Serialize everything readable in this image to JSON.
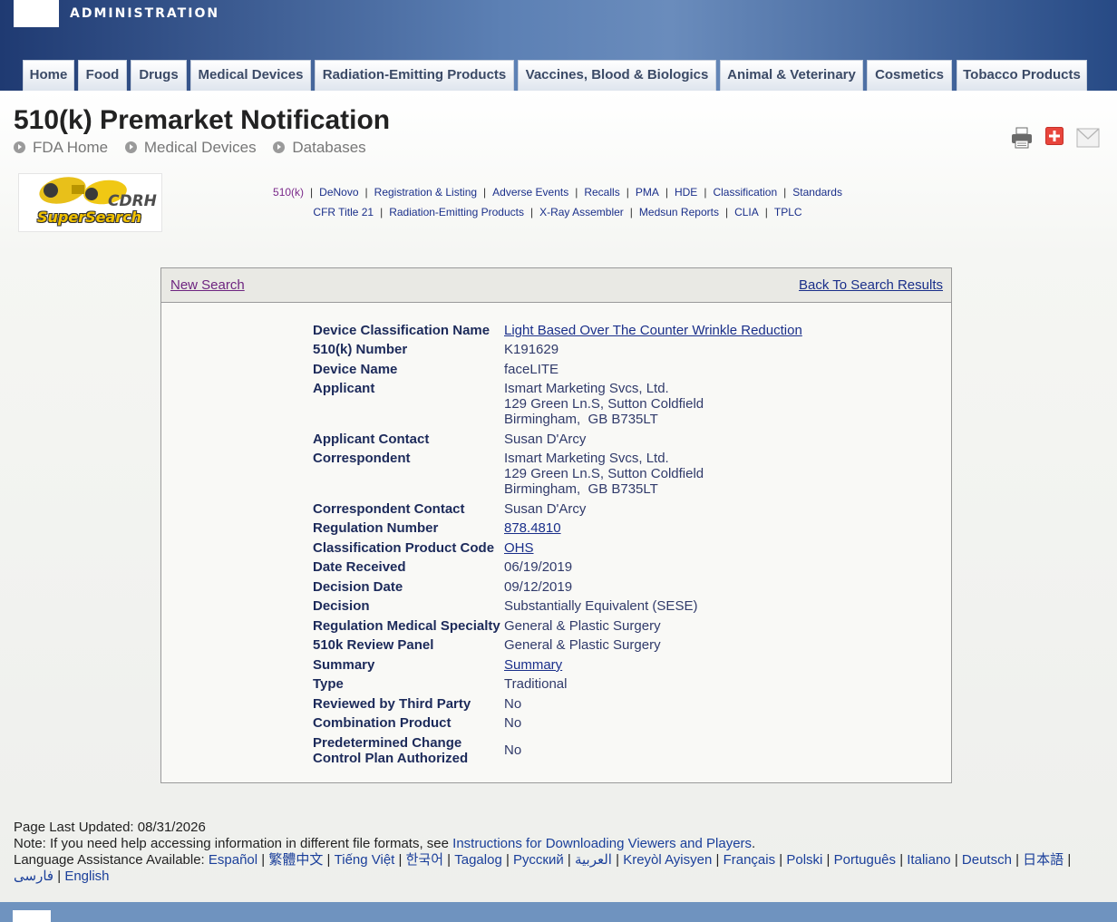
{
  "header": {
    "admin_text": "ADMINISTRATION",
    "nav_tabs": [
      "Home",
      "Food",
      "Drugs",
      "Medical Devices",
      "Radiation-Emitting Products",
      "Vaccines, Blood & Biologics",
      "Animal & Veterinary",
      "Cosmetics",
      "Tobacco Products"
    ]
  },
  "page": {
    "title": "510(k) Premarket Notification",
    "breadcrumbs": [
      "FDA Home",
      "Medical Devices",
      "Databases"
    ],
    "share_icons": [
      "print-icon",
      "add-share-icon",
      "email-icon"
    ]
  },
  "cdrh_logo": {
    "line1": "CDRH",
    "line2": "SuperSearch"
  },
  "sublinks": {
    "row1": [
      "510(k)",
      "DeNovo",
      "Registration & Listing",
      "Adverse Events",
      "Recalls",
      "PMA",
      "HDE",
      "Classification",
      "Standards"
    ],
    "row2": [
      "CFR Title 21",
      "Radiation-Emitting Products",
      "X-Ray Assembler",
      "Medsun Reports",
      "CLIA",
      "TPLC"
    ]
  },
  "panel": {
    "new_search": "New Search",
    "back_to_results": "Back To Search Results"
  },
  "record": {
    "device_classification_name": {
      "label": "Device Classification Name",
      "value": "Light Based Over The Counter Wrinkle Reduction"
    },
    "k_number": {
      "label": "510(k) Number",
      "value": "K191629"
    },
    "device_name": {
      "label": "Device Name",
      "value": "faceLITE"
    },
    "applicant": {
      "label": "Applicant",
      "line1": "Ismart Marketing Svcs, Ltd.",
      "line2": "129 Green Ln.S, Sutton Coldfield",
      "line3": "Birmingham,  GB B735LT"
    },
    "applicant_contact": {
      "label": "Applicant Contact",
      "value": "Susan D'Arcy"
    },
    "correspondent": {
      "label": "Correspondent",
      "line1": "Ismart Marketing Svcs, Ltd.",
      "line2": "129 Green Ln.S, Sutton Coldfield",
      "line3": "Birmingham,  GB B735LT"
    },
    "correspondent_contact": {
      "label": "Correspondent Contact",
      "value": "Susan D'Arcy"
    },
    "regulation_number": {
      "label": "Regulation Number",
      "value": "878.4810"
    },
    "product_code": {
      "label": "Classification Product Code",
      "value": "OHS"
    },
    "date_received": {
      "label": "Date Received",
      "value": "06/19/2019"
    },
    "decision_date": {
      "label": "Decision Date",
      "value": "09/12/2019"
    },
    "decision": {
      "label": "Decision",
      "value": "Substantially Equivalent (SESE)"
    },
    "medical_specialty": {
      "label": "Regulation Medical Specialty",
      "value": "General & Plastic Surgery"
    },
    "review_panel": {
      "label": "510k Review Panel",
      "value": "General & Plastic Surgery"
    },
    "summary": {
      "label": "Summary",
      "value": "Summary"
    },
    "type": {
      "label": "Type",
      "value": "Traditional"
    },
    "third_party": {
      "label": "Reviewed by Third Party",
      "value": "No"
    },
    "combination": {
      "label": "Combination Product",
      "value": "No"
    },
    "pccp": {
      "label_line1": "Predetermined Change",
      "label_line2": "Control Plan Authorized",
      "value": "No"
    }
  },
  "footer": {
    "last_updated": "Page Last Updated: 08/31/2026",
    "note_prefix": "Note: If you need help accessing information in different file formats, see ",
    "note_link": "Instructions for Downloading Viewers and Players",
    "note_suffix": ".",
    "language_prefix": "Language Assistance Available: ",
    "languages": [
      "Español",
      "繁體中文",
      "Tiếng Việt",
      "한국어",
      "Tagalog",
      "Русский",
      "العربية",
      "Kreyòl Ayisyen",
      "Français",
      "Polski",
      "Português",
      "Italiano",
      "Deutsch",
      "日本語",
      "فارسی",
      "English"
    ]
  }
}
